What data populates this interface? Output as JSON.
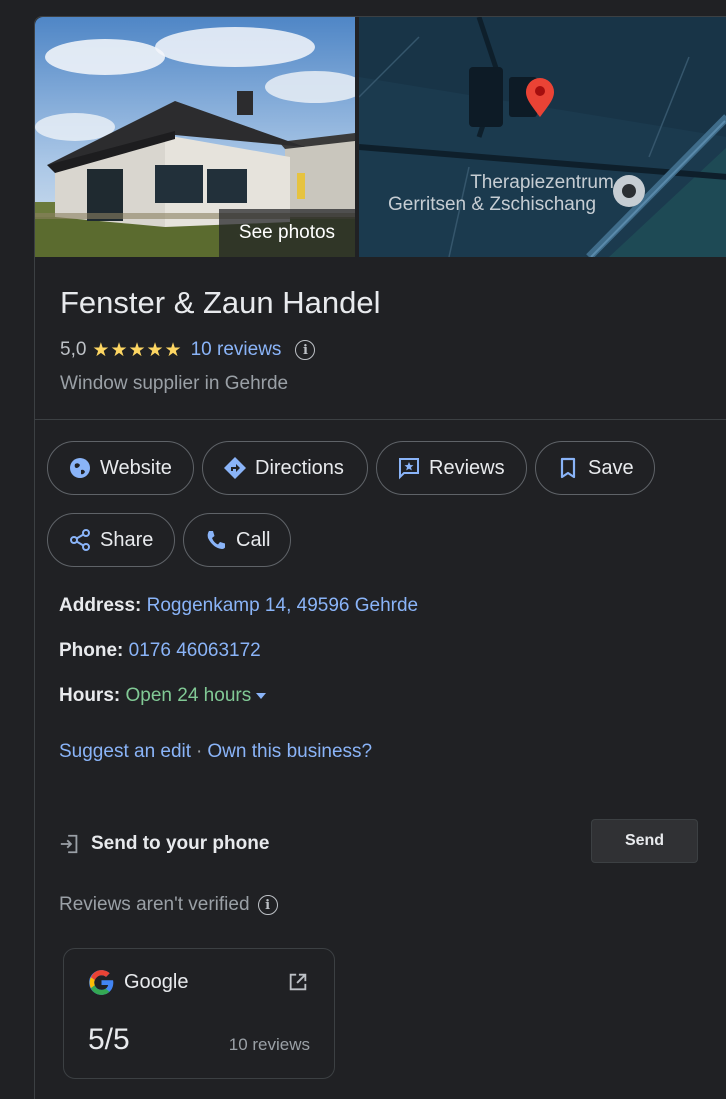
{
  "hero": {
    "see_photos_label": "See photos",
    "map_label_line1": "Therapiezentrum",
    "map_label_line2": "Gerritsen & Zschischang"
  },
  "business": {
    "name": "Fenster & Zaun Handel",
    "rating_value": "5,0",
    "stars": "★★★★★",
    "reviews_link": "10 reviews",
    "category": "Window supplier in Gehrde"
  },
  "actions": {
    "website": "Website",
    "directions": "Directions",
    "reviews": "Reviews",
    "save": "Save",
    "share": "Share",
    "call": "Call"
  },
  "details": {
    "address_label": "Address:",
    "address_value": "Roggenkamp 14, 49596 Gehrde",
    "phone_label": "Phone:",
    "phone_value": "0176 46063172",
    "hours_label": "Hours:",
    "hours_value": "Open 24 hours"
  },
  "edit_links": {
    "suggest": "Suggest an edit",
    "separator": "·",
    "own": "Own this business?"
  },
  "send_to_phone": {
    "label": "Send to your phone",
    "button": "Send"
  },
  "reviews_notice": "Reviews aren't verified",
  "review_source": {
    "name": "Google",
    "score": "5/5",
    "count": "10 reviews"
  },
  "colors": {
    "background": "#202124",
    "link": "#8ab4f8",
    "open": "#81c995",
    "star": "#fdd663",
    "map_pin": "#ea4335"
  }
}
